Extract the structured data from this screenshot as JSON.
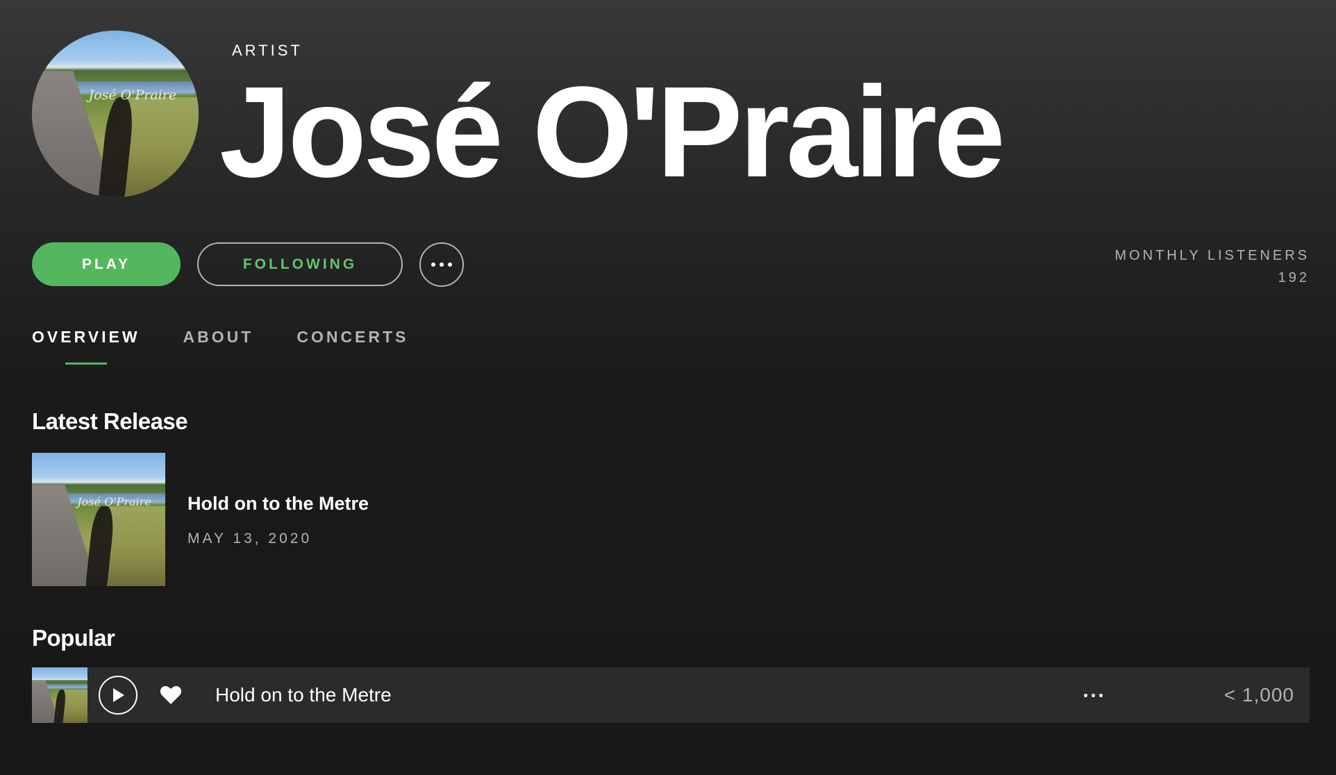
{
  "artist": {
    "label": "ARTIST",
    "name": "José O'Praire",
    "artwork_text": "José O'Praire"
  },
  "actions": {
    "play_label": "PLAY",
    "following_label": "FOLLOWING",
    "more_icon": "more-dots-icon"
  },
  "stats": {
    "monthly_listeners_label": "MONTHLY LISTENERS",
    "monthly_listeners_value": "192"
  },
  "tabs": [
    {
      "label": "OVERVIEW",
      "active": true
    },
    {
      "label": "ABOUT",
      "active": false
    },
    {
      "label": "CONCERTS",
      "active": false
    }
  ],
  "latest_release": {
    "section_title": "Latest Release",
    "title": "Hold on to the Metre",
    "date": "MAY 13, 2020",
    "artwork_text": "José O'Praire"
  },
  "popular": {
    "section_title": "Popular",
    "tracks": [
      {
        "title": "Hold on to the Metre",
        "plays": "< 1,000",
        "liked": true
      }
    ]
  },
  "colors": {
    "accent_green": "#54b75f",
    "following_text": "#62c66b",
    "secondary_text": "#b3b3b3",
    "row_background": "#2b2b2b"
  }
}
